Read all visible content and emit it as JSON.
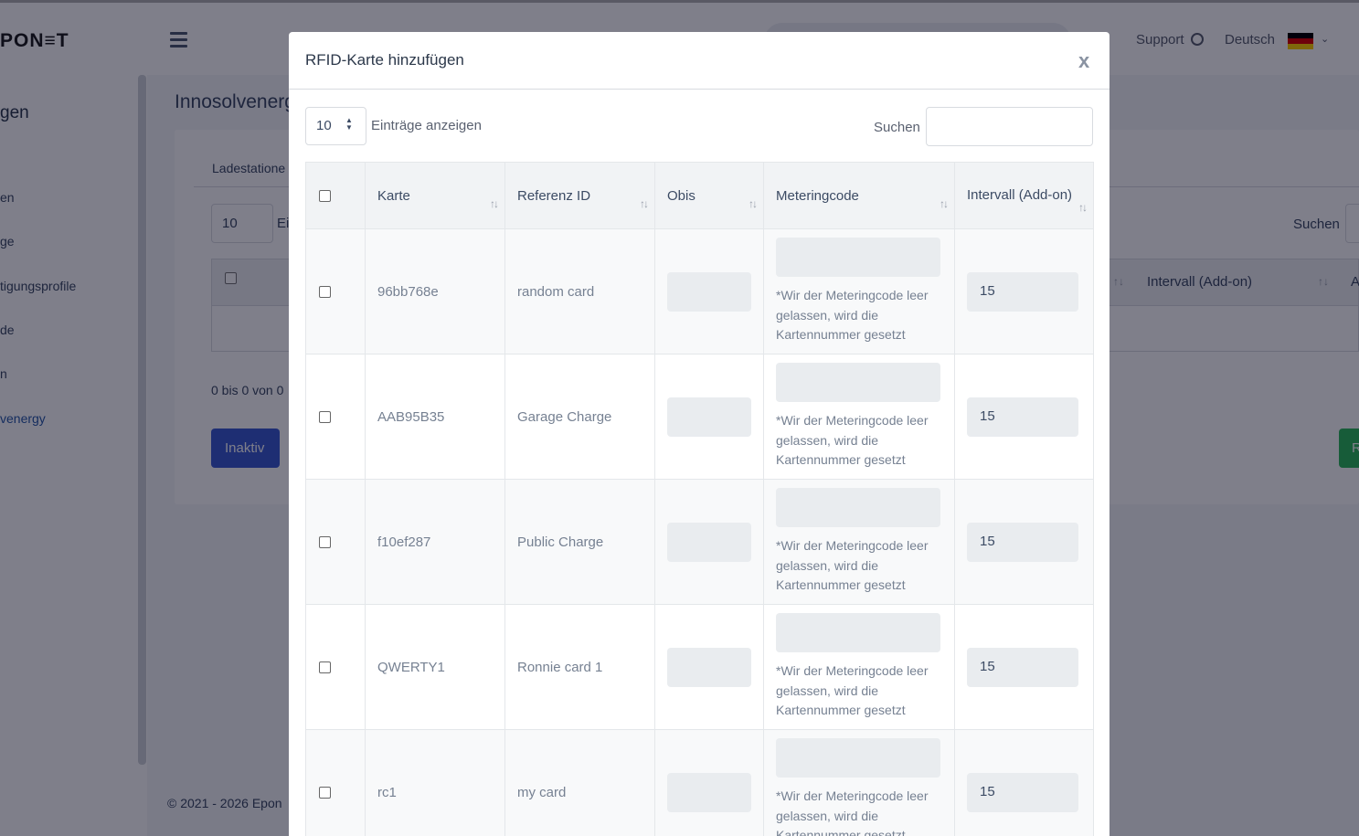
{
  "app": {
    "logo": "PON≡T",
    "support_label": "Support",
    "language_label": "Deutsch",
    "flag_colors": [
      "#000000",
      "#dd0000",
      "#ffce00"
    ]
  },
  "sidebar": {
    "heading": "gen",
    "items": [
      {
        "label": "en"
      },
      {
        "label": "ge"
      },
      {
        "label": "tigungsprofile"
      },
      {
        "label": "de"
      },
      {
        "label": "n"
      },
      {
        "label": "venergy"
      }
    ]
  },
  "background": {
    "page_title": "Innosolvenerg",
    "tab_label": "Ladestatione",
    "length_value": "10",
    "length_label_partial": "Ei",
    "search_label": "Suchen",
    "column_interval": "Intervall (Add-on)",
    "column_partial": "A",
    "count_text": "0 bis 0 von 0",
    "inactive_button": "Inaktiv",
    "green_button_partial": "R",
    "footer": "© 2021 - 2026 Epon"
  },
  "modal": {
    "title": "RFID-Karte hinzufügen",
    "close_label": "x",
    "length_value": "10",
    "length_label": "Einträge anzeigen",
    "search_label": "Suchen",
    "search_value": "",
    "columns": {
      "card": "Karte",
      "reference": "Referenz ID",
      "obis": "Obis",
      "meteringcode": "Meteringcode",
      "interval": "Intervall (Add-on)"
    },
    "hint": "*Wir der Meteringcode leer gelassen, wird die Kartennummer gesetzt",
    "rows": [
      {
        "card": "96bb768e",
        "reference": "random card",
        "interval": "15"
      },
      {
        "card": "AAB95B35",
        "reference": "Garage Charge",
        "interval": "15"
      },
      {
        "card": "f10ef287",
        "reference": "Public Charge",
        "interval": "15"
      },
      {
        "card": "QWERTY1",
        "reference": "Ronnie card 1",
        "interval": "15"
      },
      {
        "card": "rc1",
        "reference": "my card",
        "interval": "15"
      }
    ]
  }
}
